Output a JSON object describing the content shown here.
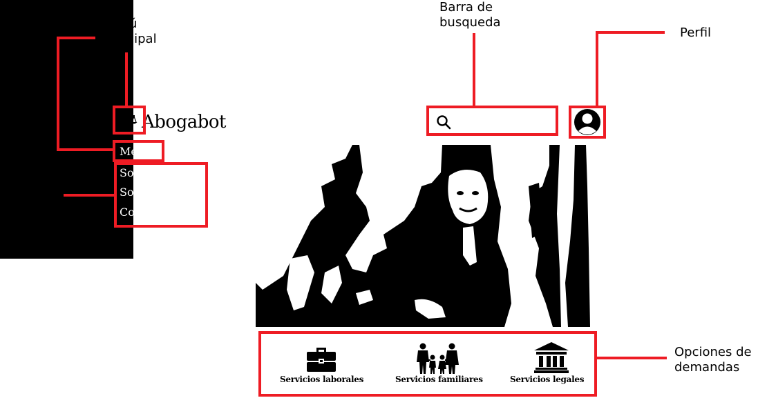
{
  "brand": {
    "name": "Abogabot",
    "logo_icon": "scales-of-justice-icon"
  },
  "sidebar": {
    "menu_label": "Menú",
    "options": [
      "Sobre nosotros",
      "Solicitudes",
      "Contactos"
    ]
  },
  "search": {
    "icon": "search-icon",
    "value": ""
  },
  "profile": {
    "icon": "user-avatar-icon"
  },
  "hero": {
    "description_icon": "hero-image"
  },
  "services": [
    {
      "label": "Servicios laborales",
      "icon": "briefcase-icon"
    },
    {
      "label": "Servicios familiares",
      "icon": "family-icon"
    },
    {
      "label": "Servicios legales",
      "icon": "courthouse-icon"
    }
  ],
  "annotations": {
    "menu_principal": "Menú\nprincipal",
    "barra_busqueda": "Barra de\nbusqueda",
    "perfil": "Perfil",
    "opciones": "Opciones",
    "opciones_demandas": "Opciones de\ndemandas"
  },
  "colors": {
    "annotation": "#ee1c24",
    "sidebar": "#000000",
    "background": "#ffffff"
  }
}
